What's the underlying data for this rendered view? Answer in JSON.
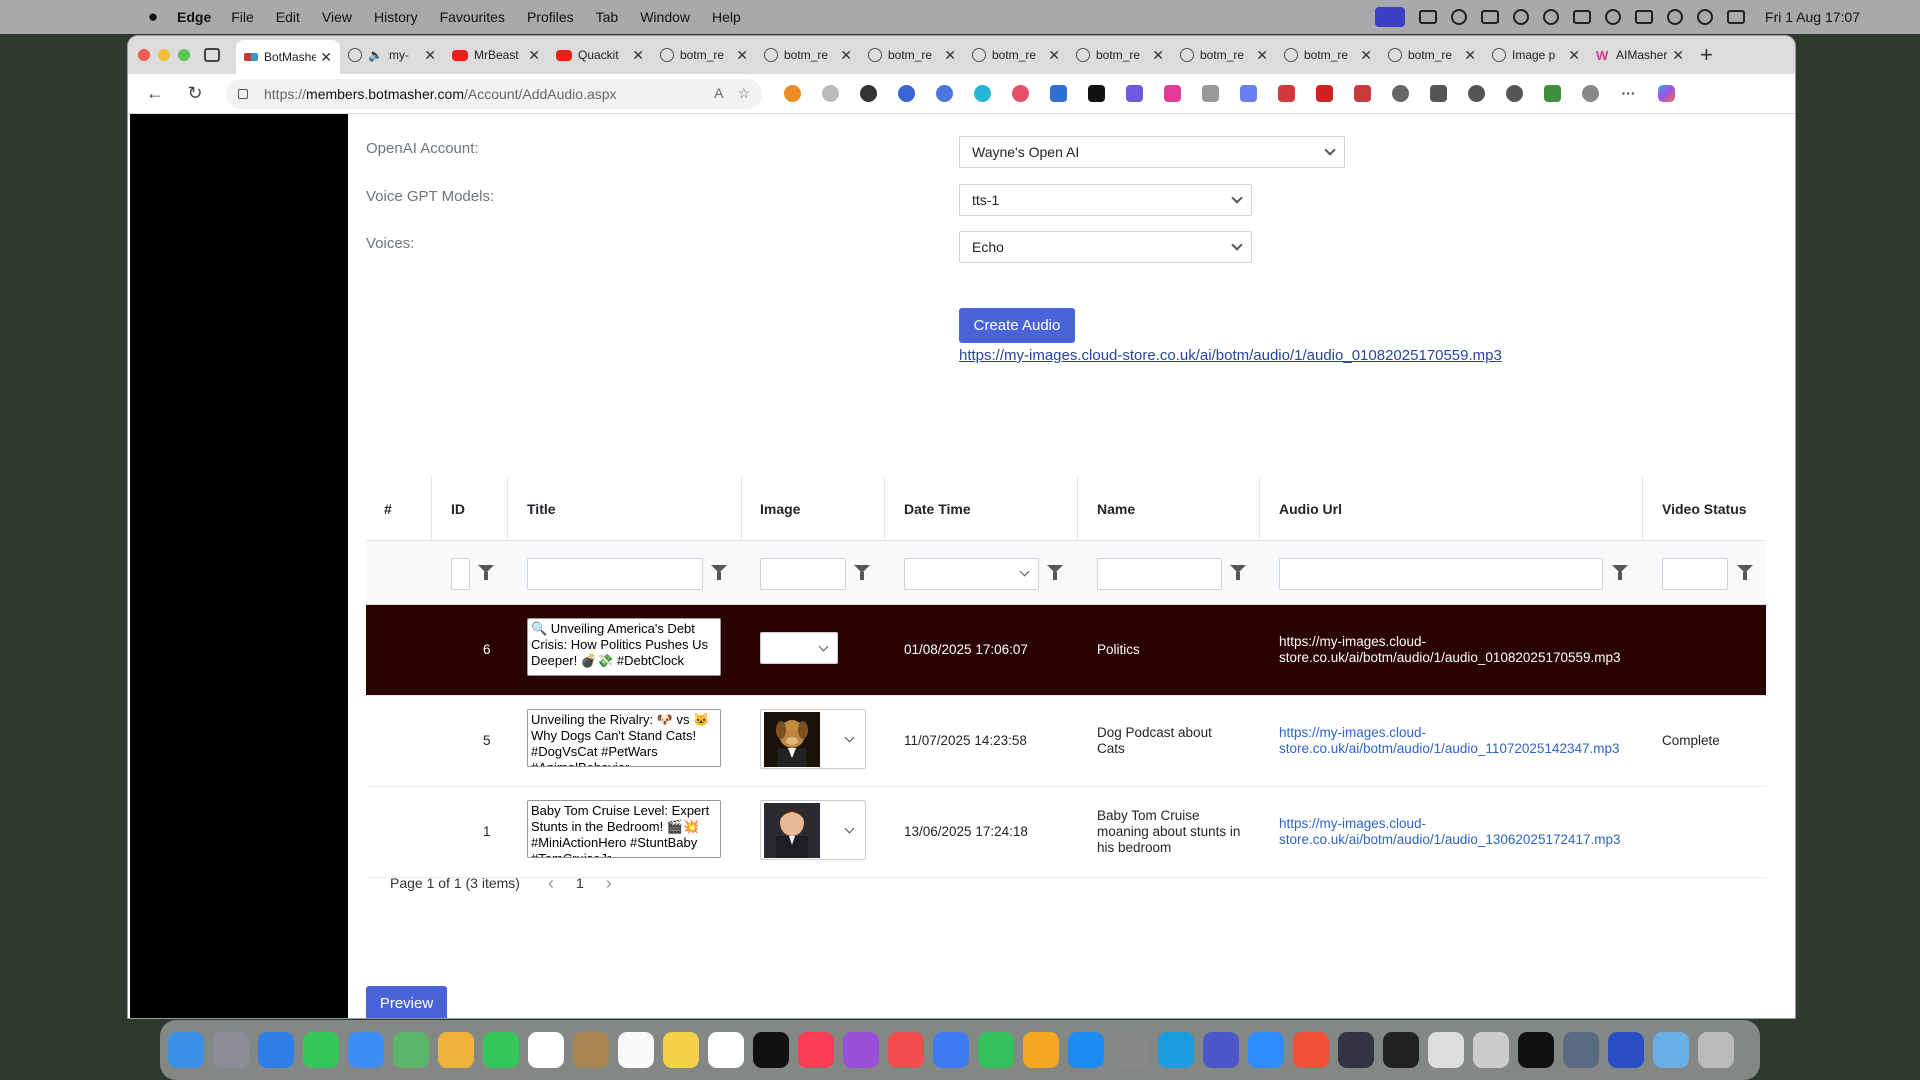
{
  "menubar": {
    "app_name": "Edge",
    "items": [
      "File",
      "Edit",
      "View",
      "History",
      "Favourites",
      "Profiles",
      "Tab",
      "Window",
      "Help"
    ],
    "clock": "Fri 1 Aug  17:07"
  },
  "browser": {
    "tabs": [
      {
        "label": "BotMasher",
        "icon": "botmasher-favicon",
        "active": true
      },
      {
        "label": "my-",
        "icon": "globe-icon"
      },
      {
        "label": "MrBeast",
        "icon": "youtube-icon"
      },
      {
        "label": "Quackit",
        "icon": "youtube-icon"
      },
      {
        "label": "botm_re",
        "icon": "globe-icon"
      },
      {
        "label": "botm_re",
        "icon": "globe-icon"
      },
      {
        "label": "botm_re",
        "icon": "globe-icon"
      },
      {
        "label": "botm_re",
        "icon": "globe-icon"
      },
      {
        "label": "botm_re",
        "icon": "globe-icon"
      },
      {
        "label": "botm_re",
        "icon": "globe-icon"
      },
      {
        "label": "botm_re",
        "icon": "globe-icon"
      },
      {
        "label": "botm_re",
        "icon": "globe-icon"
      },
      {
        "label": "Image p",
        "icon": "openai-icon"
      },
      {
        "label": "AIMasher",
        "icon": "aimasher-icon"
      }
    ],
    "address": {
      "prefix": "https://",
      "host": "members.botmasher.com",
      "path": "/Account/AddAudio.aspx"
    }
  },
  "form": {
    "openai_label": "OpenAI Account:",
    "openai_value": "Wayne's Open AI",
    "models_label": "Voice GPT Models:",
    "models_value": "tts-1",
    "voices_label": "Voices:",
    "voices_value": "Echo",
    "create_button": "Create Audio",
    "result_link": "https://my-images.cloud-store.co.uk/ai/botm/audio/1/audio_01082025170559.mp3"
  },
  "grid": {
    "columns": [
      "#",
      "ID",
      "Title",
      "Image",
      "Date Time",
      "Name",
      "Audio Url",
      "Video Status"
    ],
    "rows": [
      {
        "id": "6",
        "title": "🔍 Unveiling America's Debt Crisis: How Politics Pushes Us Deeper! 💣💸 #DebtClock",
        "datetime": "01/08/2025 17:06:07",
        "name": "Politics",
        "audio_url_1": "https://my-images.cloud-",
        "audio_url_2": "store.co.uk/ai/botm/audio/1/audio_01082025170559.mp3",
        "status": "",
        "selected": true
      },
      {
        "id": "5",
        "title": "Unveiling the Rivalry: 🐶 vs 🐱 Why Dogs Can't Stand Cats! #DogVsCat #PetWars #AnimalBehavior",
        "datetime": "11/07/2025 14:23:58",
        "name": "Dog Podcast about Cats",
        "audio_url_1": "https://my-images.cloud-",
        "audio_url_2": "store.co.uk/ai/botm/audio/1/audio_11072025142347.mp3",
        "status": "Complete",
        "selected": false
      },
      {
        "id": "1",
        "title": "Baby Tom Cruise Level: Expert Stunts in the Bedroom! 🎬💥 #MiniActionHero #StuntBaby #TomCruiseJr",
        "datetime": "13/06/2025 17:24:18",
        "name": "Baby Tom Cruise moaning about stunts in his bedroom",
        "audio_url_1": "https://my-images.cloud-",
        "audio_url_2": "store.co.uk/ai/botm/audio/1/audio_13062025172417.mp3",
        "status": "",
        "selected": false
      }
    ],
    "pager_info": "Page 1 of 1 (3 items)",
    "page_number": "1"
  },
  "preview_button": "Preview",
  "colors": {
    "primary": "#4b63d8",
    "selected_row": "#2a0303",
    "link": "#2e63c8"
  }
}
